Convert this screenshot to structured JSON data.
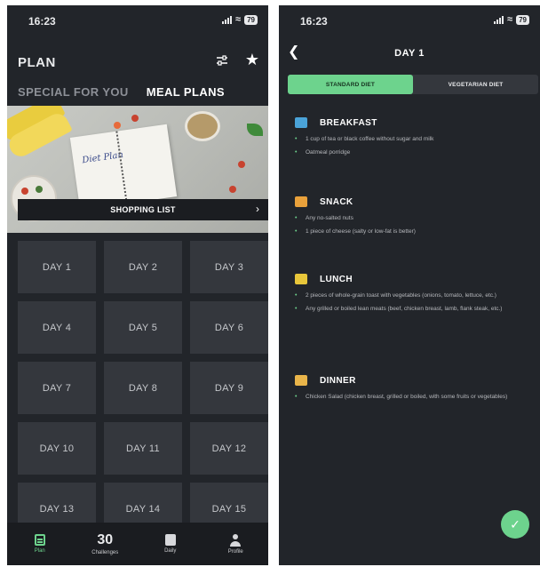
{
  "status_left": {
    "time": "16:23",
    "battery": "79"
  },
  "status_right": {
    "time": "16:23",
    "battery": "79"
  },
  "plan": {
    "title": "PLAN",
    "tabs": [
      {
        "label": "SPECIAL FOR YOU",
        "active": false
      },
      {
        "label": "MEAL PLANS",
        "active": true
      }
    ],
    "banner": {
      "notebook_text": "Diet Plan",
      "shopping_label": "SHOPPING LIST"
    },
    "days": [
      "DAY 1",
      "DAY 2",
      "DAY 3",
      "DAY 4",
      "DAY 5",
      "DAY 6",
      "DAY 7",
      "DAY 8",
      "DAY 9",
      "DAY 10",
      "DAY 11",
      "DAY 12",
      "DAY 13",
      "DAY 14",
      "DAY 15"
    ]
  },
  "bottom_nav": [
    {
      "label": "Plan",
      "icon": "plan-icon",
      "active": true
    },
    {
      "label": "Challenges",
      "icon": "30",
      "active": false
    },
    {
      "label": "Daily",
      "icon": "daily-icon",
      "active": false
    },
    {
      "label": "Profile",
      "icon": "profile-icon",
      "active": false
    }
  ],
  "day_detail": {
    "title": "DAY 1",
    "diet_options": [
      {
        "label": "STANDARD DIET",
        "active": true
      },
      {
        "label": "VEGETARIAN DIET",
        "active": false
      }
    ],
    "meals": [
      {
        "name": "BREAKFAST",
        "color": "#4aa3d8",
        "items": [
          "1 cup of tea or black coffee without sugar and milk",
          "Oatmeal porridge"
        ]
      },
      {
        "name": "SNACK",
        "color": "#e9a13b",
        "items": [
          "Any no-salted nuts",
          "1 piece of cheese (salty or low-fat is better)"
        ]
      },
      {
        "name": "LUNCH",
        "color": "#e8c63a",
        "items": [
          "2 pieces of whole-grain toast with vegetables (onions, tomato, lettuce, etc.)",
          "Any grilled or boiled lean meats (beef, chicken breast, lamb, flank steak, etc.)"
        ]
      },
      {
        "name": "DINNER",
        "color": "#e9b54a",
        "items": [
          "Chicken Salad (chicken breast, grilled or boiled, with some fruits or vegetables)"
        ]
      }
    ]
  },
  "colors": {
    "accent": "#6dd38d",
    "bg": "#22252a",
    "tile": "#34373d"
  }
}
